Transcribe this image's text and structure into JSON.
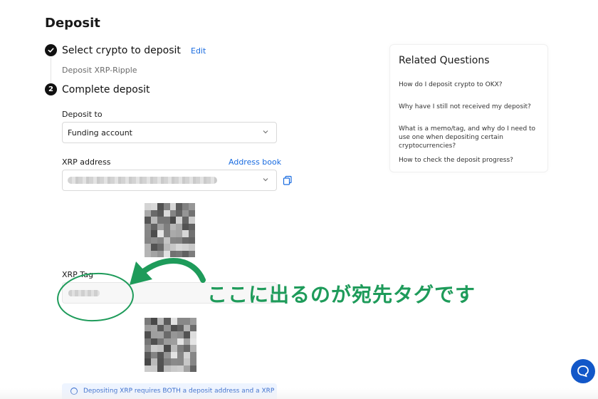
{
  "page": {
    "title": "Deposit"
  },
  "steps": [
    {
      "number": "",
      "label": "Select crypto to deposit",
      "action": "Edit",
      "summary": "Deposit XRP-Ripple",
      "status": "completed"
    },
    {
      "number": "2",
      "label": "Complete deposit",
      "status": "current"
    }
  ],
  "form": {
    "deposit_to": {
      "label": "Deposit to",
      "value": "Funding account"
    },
    "xrp_address": {
      "label": "XRP address",
      "address_book": "Address book"
    },
    "xrp_tag": {
      "label": "XRP Tag"
    }
  },
  "annotation": {
    "text": "ここに出るのが宛先タグです",
    "color": "#1e9b5a"
  },
  "related": {
    "title": "Related Questions",
    "questions": [
      "How do I deposit crypto to OKX?",
      "Why have I still not received my deposit?",
      "What is a memo/tag, and why do I need to use one when depositing certain cryptocurrencies?",
      "How to check the deposit progress?"
    ]
  },
  "notice": {
    "text": "Depositing XRP requires BOTH a deposit address and a XRP"
  },
  "colors": {
    "link": "#1a6ce0",
    "annotation": "#1e9b5a",
    "chat": "#1257c8"
  },
  "icons": [
    "check-circle-icon",
    "chevron-down-icon",
    "copy-icon",
    "info-icon",
    "chat-icon"
  ]
}
